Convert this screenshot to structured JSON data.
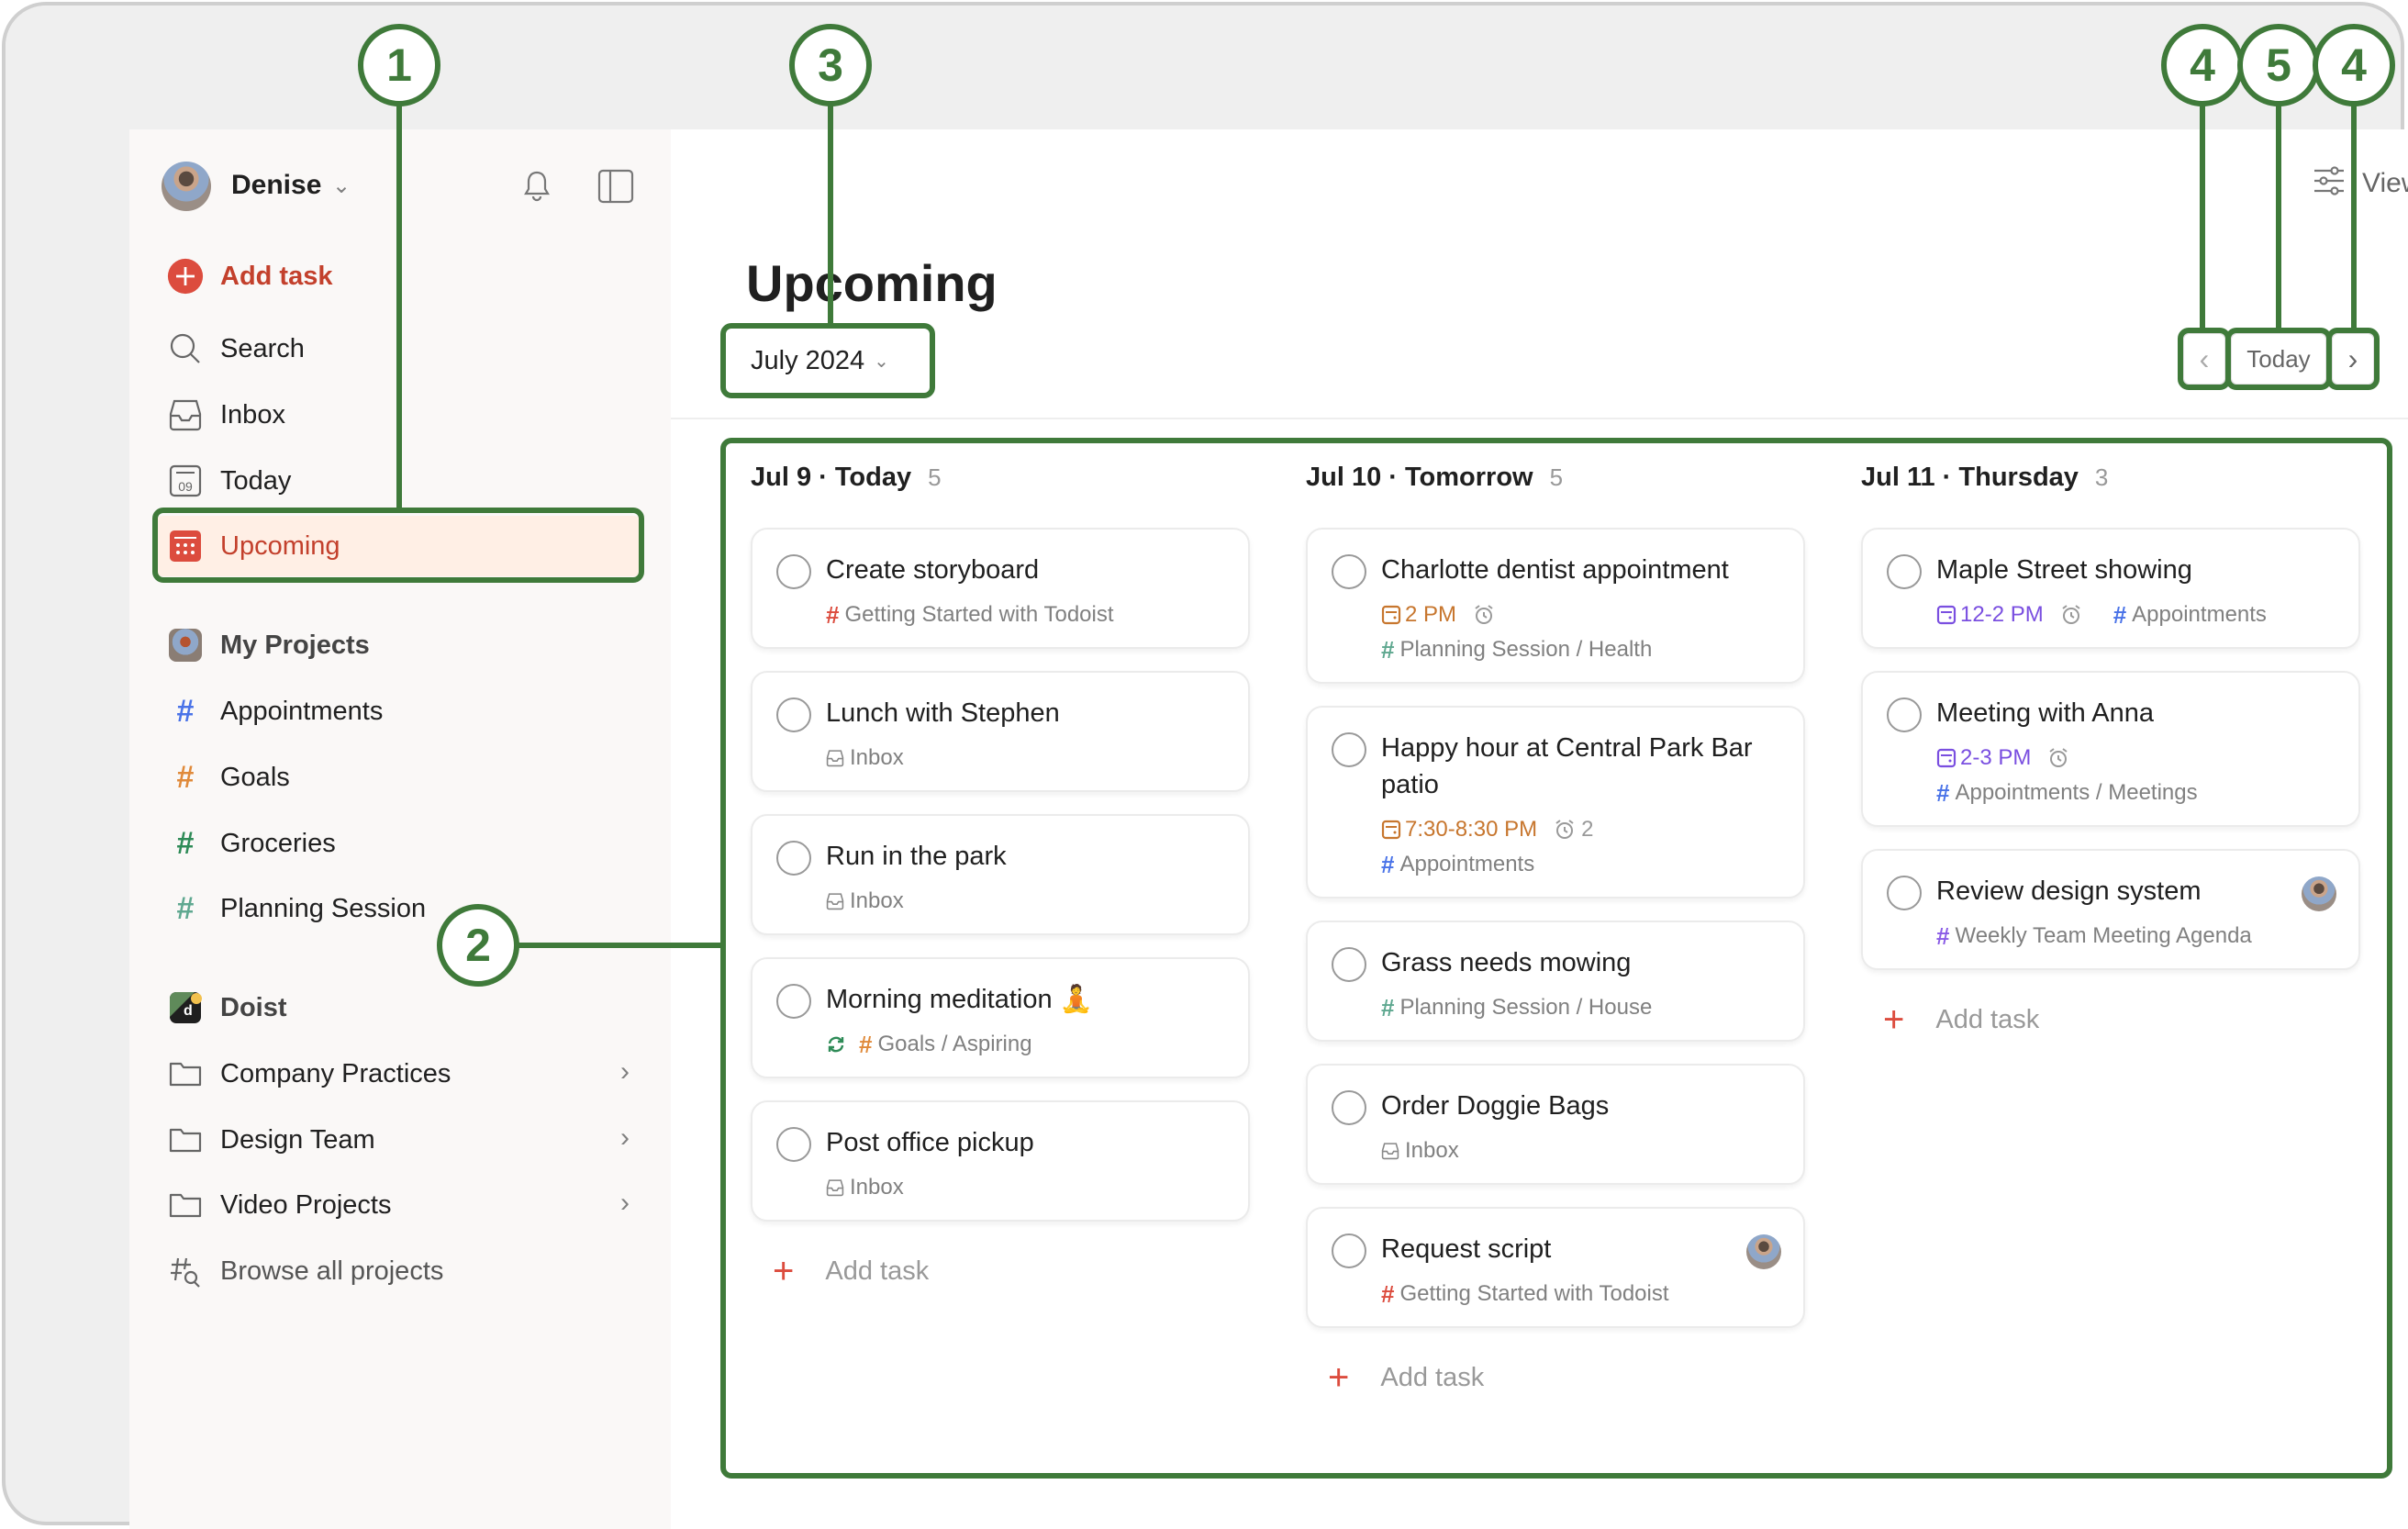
{
  "colors": {
    "accent": "#dc4c3e",
    "accent_text": "#c3402c",
    "active_bg": "#ffefe5",
    "annotation": "#3f7a3a",
    "project_blue": "#4a73e8",
    "project_orange": "#e08a3a",
    "project_green": "#2e8b57",
    "project_teal": "#5fa890",
    "project_red": "#dc4c3e",
    "project_purple": "#8a5ce6",
    "date_orange": "#c7762e",
    "date_purple": "#7a4fe0"
  },
  "sidebar": {
    "user_name": "Denise",
    "bell_icon": "bell-icon",
    "panel_icon": "sidebar-toggle-icon",
    "add_task_label": "Add task",
    "nav": [
      {
        "label": "Search",
        "icon": "search-icon"
      },
      {
        "label": "Inbox",
        "icon": "inbox-icon"
      },
      {
        "label": "Today",
        "icon": "today-calendar-icon",
        "icon_text": "09"
      },
      {
        "label": "Upcoming",
        "icon": "upcoming-calendar-icon",
        "active": true
      }
    ],
    "my_projects": {
      "label": "My Projects",
      "items": [
        {
          "label": "Appointments",
          "color": "#4a73e8"
        },
        {
          "label": "Goals",
          "color": "#e08a3a"
        },
        {
          "label": "Groceries",
          "color": "#2e8b57"
        },
        {
          "label": "Planning Session",
          "color": "#5fa890"
        }
      ]
    },
    "team": {
      "label": "Doist",
      "folders": [
        {
          "label": "Company Practices"
        },
        {
          "label": "Design Team"
        },
        {
          "label": "Video Projects"
        }
      ],
      "browse_label": "Browse all projects"
    }
  },
  "header": {
    "view_label": "View",
    "title": "Upcoming",
    "month_label": "July 2024",
    "today_label": "Today",
    "prev_icon": "chevron-left-icon",
    "next_icon": "chevron-right-icon"
  },
  "board": {
    "add_task_label": "Add task",
    "columns": [
      {
        "date": "Jul 9 · Today",
        "count": "5",
        "tasks": [
          {
            "title": "Create storyboard",
            "project": "Getting Started with Todoist",
            "project_color": "#dc4c3e"
          },
          {
            "title": "Lunch with Stephen",
            "project": "Inbox",
            "inbox": true
          },
          {
            "title": "Run in the park",
            "project": "Inbox",
            "inbox": true
          },
          {
            "title": "Morning meditation 🧘",
            "project": "Goals / Aspiring",
            "project_color": "#e08a3a",
            "recurring": true
          },
          {
            "title": "Post office pickup",
            "project": "Inbox",
            "inbox": true
          }
        ]
      },
      {
        "date": "Jul 10 · Tomorrow",
        "count": "5",
        "tasks": [
          {
            "title": "Charlotte dentist appointment",
            "time": "2 PM",
            "time_color": "#c7762e",
            "reminder": "",
            "project": "Planning Session / Health",
            "project_color": "#5fa890"
          },
          {
            "title": "Happy hour at Central Park Bar patio",
            "time": "7:30-8:30 PM",
            "time_color": "#c7762e",
            "reminder": "2",
            "project": "Appointments",
            "project_color": "#4a73e8"
          },
          {
            "title": "Grass needs mowing",
            "project": "Planning Session / House",
            "project_color": "#5fa890"
          },
          {
            "title": "Order Doggie Bags",
            "project": "Inbox",
            "inbox": true
          },
          {
            "title": "Request script",
            "project": "Getting Started with Todoist",
            "project_color": "#dc4c3e",
            "assignee": true
          }
        ]
      },
      {
        "date": "Jul 11 · Thursday",
        "count": "3",
        "tasks": [
          {
            "title": "Maple Street showing",
            "time": "12-2 PM",
            "time_color": "#7a4fe0",
            "reminder": "",
            "project": "Appointments",
            "project_color": "#4a73e8",
            "inline_project": true
          },
          {
            "title": "Meeting with Anna",
            "time": "2-3 PM",
            "time_color": "#7a4fe0",
            "reminder": "",
            "project": "Appointments / Meetings",
            "project_color": "#4a73e8"
          },
          {
            "title": "Review design system",
            "project": "Weekly Team Meeting Agenda",
            "project_color": "#8a5ce6",
            "assignee": true
          }
        ]
      }
    ]
  },
  "annotations": [
    {
      "number": "1",
      "target": "Upcoming sidebar item"
    },
    {
      "number": "2",
      "target": "Upcoming board"
    },
    {
      "number": "3",
      "target": "Month picker"
    },
    {
      "number": "4",
      "target": "Previous week button"
    },
    {
      "number": "5",
      "target": "Today button"
    },
    {
      "number": "4",
      "target": "Next week button"
    }
  ]
}
